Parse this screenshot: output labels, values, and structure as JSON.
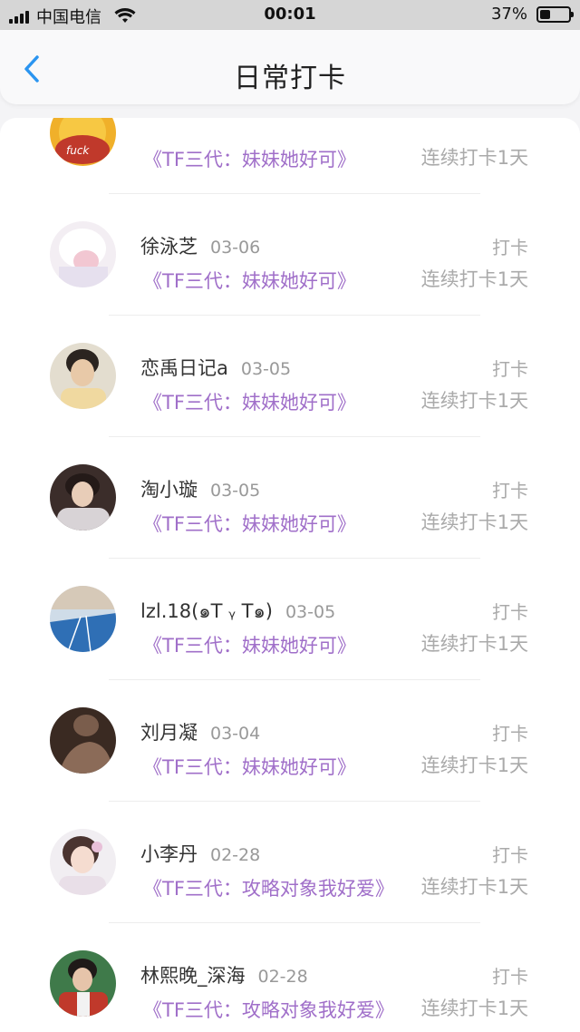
{
  "status": {
    "carrier": "中国电信",
    "time": "00:01",
    "battery": "37%",
    "battery_level": 0.37
  },
  "header": {
    "title": "日常打卡",
    "back_icon": "chevron-left-icon"
  },
  "colors": {
    "accent": "#2b95f0",
    "title_purple": "#a06fc9",
    "muted": "#aaaaaa"
  },
  "items": [
    {
      "name": "",
      "date": "",
      "title": "《TF三代：妹妹她好可》",
      "action": "",
      "streak": "连续打卡1天",
      "avatar_text": "fuck"
    },
    {
      "name": "徐泳芝",
      "date": "03-06",
      "title": "《TF三代：妹妹她好可》",
      "action": "打卡",
      "streak": "连续打卡1天"
    },
    {
      "name": "恋禹日记a",
      "date": "03-05",
      "title": "《TF三代：妹妹她好可》",
      "action": "打卡",
      "streak": "连续打卡1天"
    },
    {
      "name": "淘小璇",
      "date": "03-05",
      "title": "《TF三代：妹妹她好可》",
      "action": "打卡",
      "streak": "连续打卡1天"
    },
    {
      "name": "lzl.18(๑T ᵧ T๑)",
      "date": "03-05",
      "title": "《TF三代：妹妹她好可》",
      "action": "打卡",
      "streak": "连续打卡1天"
    },
    {
      "name": "刘月凝",
      "date": "03-04",
      "title": "《TF三代：妹妹她好可》",
      "action": "打卡",
      "streak": "连续打卡1天"
    },
    {
      "name": "小李丹",
      "date": "02-28",
      "title": "《TF三代：攻略对象我好爱》",
      "action": "打卡",
      "streak": "连续打卡1天"
    },
    {
      "name": "林熙晚_深海",
      "date": "02-28",
      "title": "《TF三代：攻略对象我好爱》",
      "action": "打卡",
      "streak": "连续打卡1天"
    }
  ]
}
